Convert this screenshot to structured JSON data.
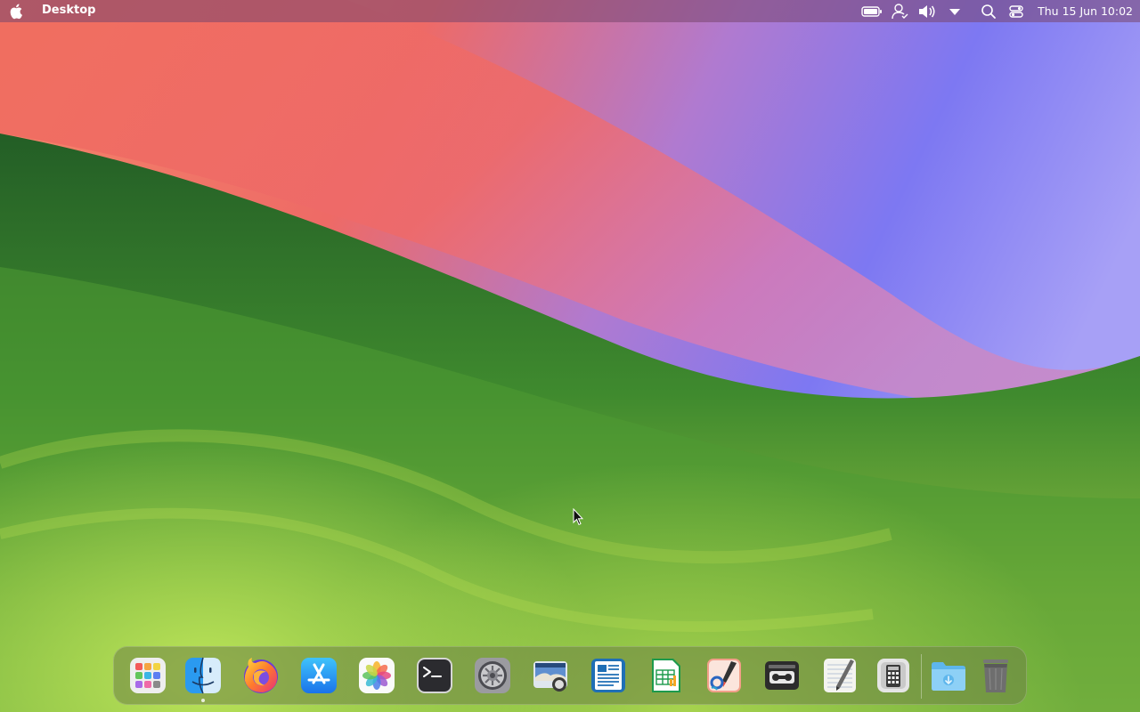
{
  "menubar": {
    "app_title": "Desktop",
    "clock": "Thu 15 Jun 10:02",
    "status_icons": [
      "battery-icon",
      "user-icon",
      "volume-icon",
      "dropdown-arrow-icon",
      "search-icon",
      "control-center-icon"
    ]
  },
  "dock": {
    "items": [
      {
        "name": "launchpad-icon"
      },
      {
        "name": "finder-icon",
        "running": true
      },
      {
        "name": "firefox-icon"
      },
      {
        "name": "app-store-icon"
      },
      {
        "name": "photos-icon"
      },
      {
        "name": "terminal-icon"
      },
      {
        "name": "system-settings-icon"
      },
      {
        "name": "screenshot-icon"
      },
      {
        "name": "document-viewer-icon"
      },
      {
        "name": "spreadsheet-icon"
      },
      {
        "name": "paint-icon"
      },
      {
        "name": "cassette-recorder-icon"
      },
      {
        "name": "text-editor-icon"
      },
      {
        "name": "calculator-icon"
      },
      {
        "name": "downloads-folder-icon"
      },
      {
        "name": "trash-icon"
      }
    ]
  },
  "colors": {
    "wallpaper_green": "#3d8a2a",
    "wallpaper_red": "#ef6660",
    "wallpaper_purple": "#8a7bf0"
  }
}
